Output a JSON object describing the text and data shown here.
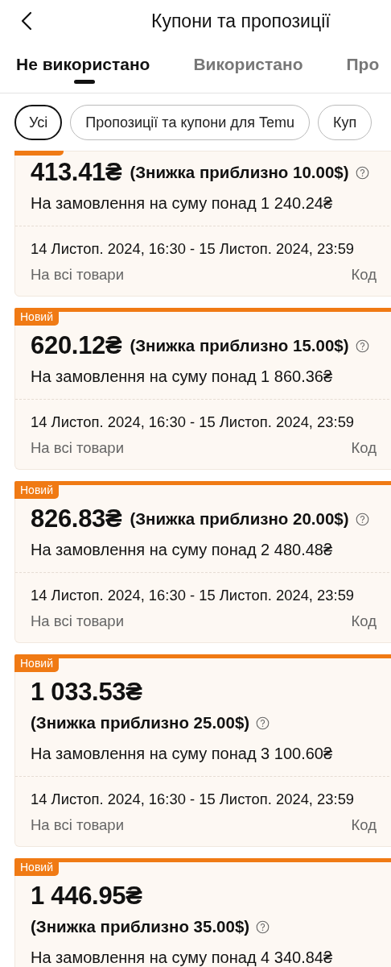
{
  "header": {
    "title": "Купони та пропозиції"
  },
  "tabs": [
    {
      "label": "Не використано",
      "selected": true
    },
    {
      "label": "Використано",
      "selected": false
    },
    {
      "label": "Про",
      "selected": false
    }
  ],
  "filters": [
    {
      "label": "Усі",
      "selected": true
    },
    {
      "label": "Пропозиції та купони для Temu",
      "selected": false
    },
    {
      "label": "Куп",
      "selected": false
    }
  ],
  "coupons": [
    {
      "amount": "413.41₴",
      "discount": "(Знижка приблизно 10.00$)",
      "condition": "На замовлення на суму понад 1 240.24₴",
      "validity": "14 Листоп. 2024, 16:30 - 15 Листоп. 2024, 23:59",
      "scope": "На всі товари",
      "code": "Код"
    },
    {
      "badge": "Новий",
      "amount": "620.12₴",
      "discount": "(Знижка приблизно 15.00$)",
      "condition": "На замовлення на суму понад 1 860.36₴",
      "validity": "14 Листоп. 2024, 16:30 - 15 Листоп. 2024, 23:59",
      "scope": "На всі товари",
      "code": "Код"
    },
    {
      "badge": "Новий",
      "amount": "826.83₴",
      "discount": "(Знижка приблизно 20.00$)",
      "condition": "На замовлення на суму понад 2 480.48₴",
      "validity": "14 Листоп. 2024, 16:30 - 15 Листоп. 2024, 23:59",
      "scope": "На всі товари",
      "code": "Код"
    },
    {
      "badge": "Новий",
      "amount": "1 033.53₴",
      "discount": "(Знижка приблизно 25.00$)",
      "condition": "На замовлення на суму понад 3 100.60₴",
      "validity": "14 Листоп. 2024, 16:30 - 15 Листоп. 2024, 23:59",
      "scope": "На всі товари",
      "code": "Код"
    },
    {
      "badge": "Новий",
      "amount": "1 446.95₴",
      "discount": "(Знижка приблизно 35.00$)",
      "condition": "На замовлення на суму понад 4 340.84₴"
    }
  ]
}
